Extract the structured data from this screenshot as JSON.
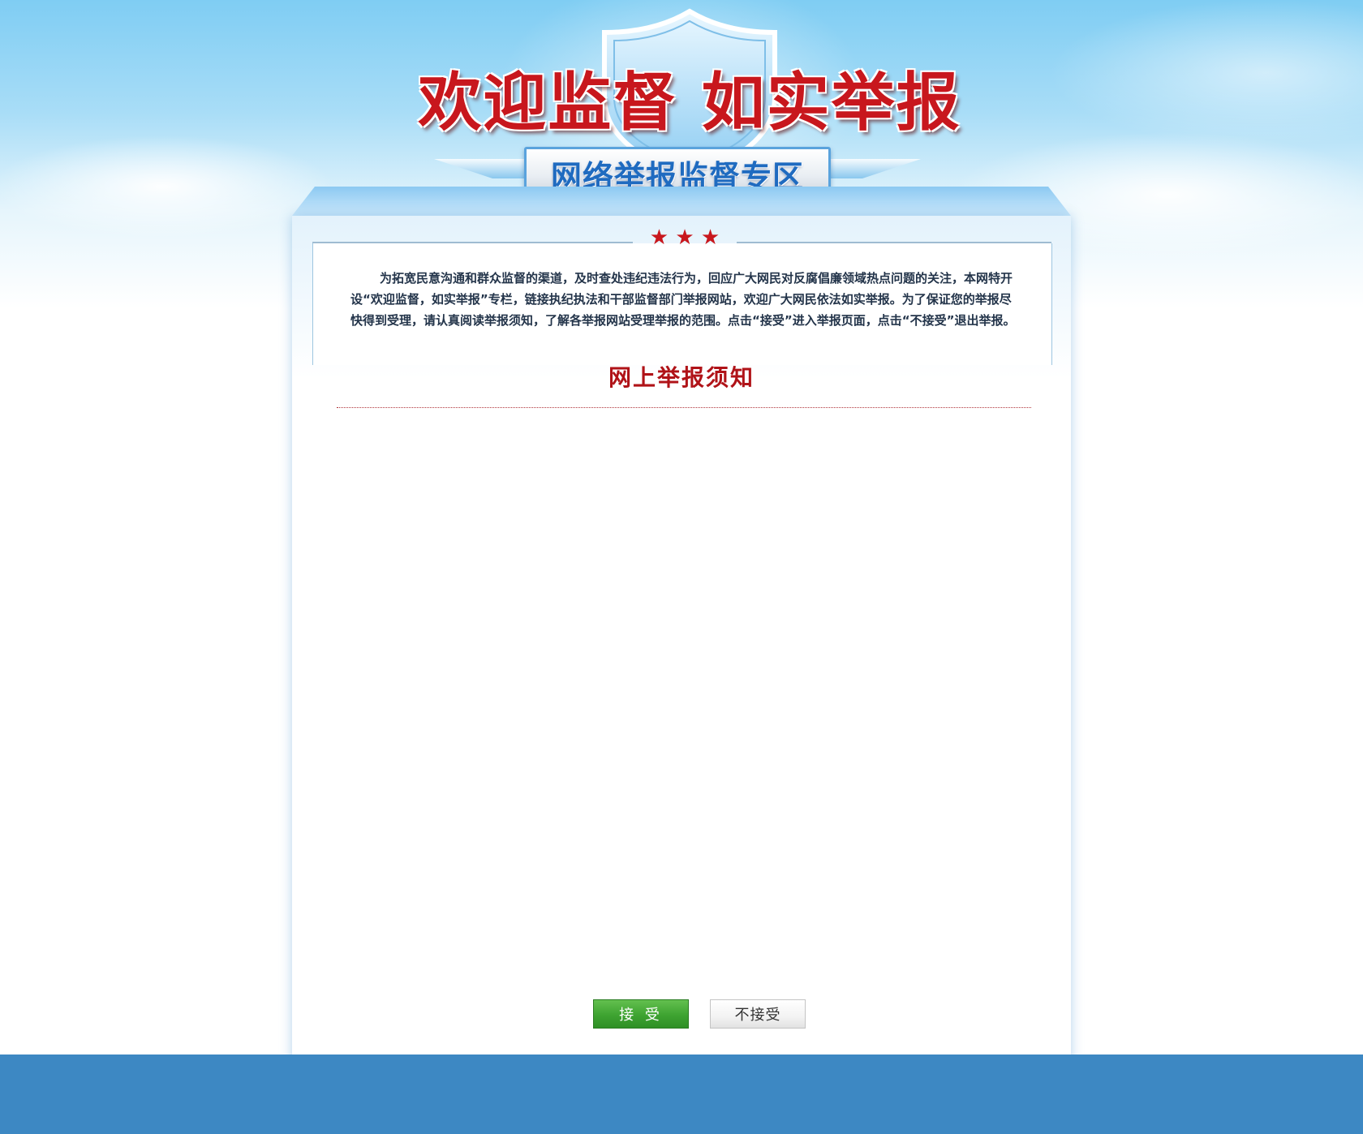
{
  "header": {
    "slogan": "欢迎监督  如实举报",
    "subtitle": "网络举报监督专区"
  },
  "panel": {
    "stars": "★ ★ ★",
    "intro": "为拓宽民意沟通和群众监督的渠道，及时查处违纪违法行为，回应广大网民对反腐倡廉领域热点问题的关注，本网特开设“欢迎监督，如实举报”专栏，链接执纪执法和干部监督部门举报网站，欢迎广大网民依法如实举报。为了保证您的举报尽快得到受理，请认真阅读举报须知，了解各举报网站受理举报的范围。点击“接受”进入举报页面，点击“不接受”退出举报。",
    "notice_title": "网上举报须知"
  },
  "buttons": {
    "accept_label": "接 受",
    "decline_label": "不接受"
  },
  "colors": {
    "accent_red": "#c8171d",
    "title_blue": "#1f6bc0",
    "accept_green": "#3ea331",
    "footer_blue": "#3d88c3"
  }
}
